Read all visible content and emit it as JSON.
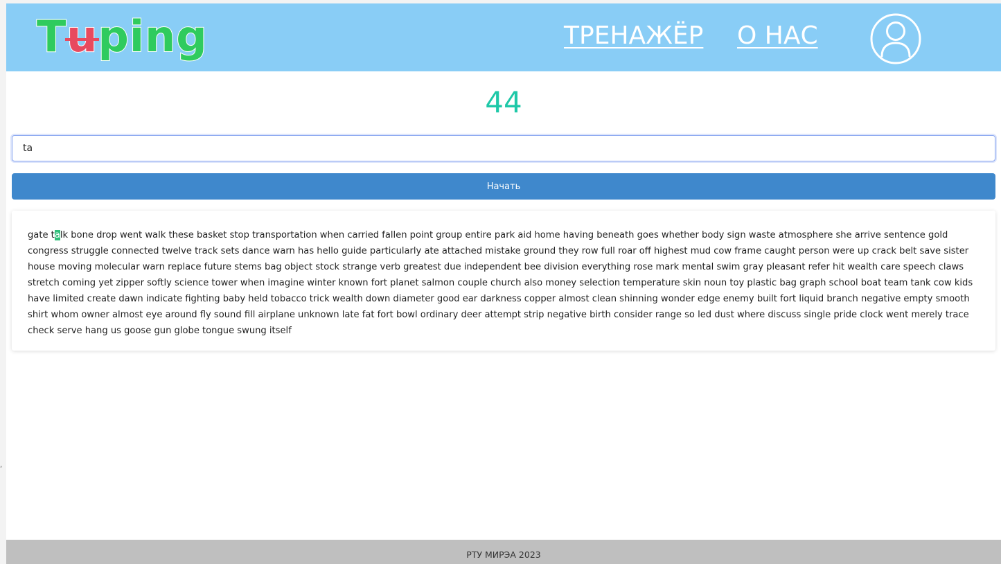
{
  "header": {
    "logo": {
      "part1": "T",
      "part2": "u",
      "part3": "ping"
    },
    "nav": {
      "trainer_label": "ТРЕНАЖЁР",
      "about_label": "О НАС"
    },
    "profile_icon": "user-circle-icon"
  },
  "main": {
    "counter": "44",
    "input_value": "ta",
    "start_label": "Начать",
    "text": {
      "typed": "gate t",
      "current_char": "a",
      "remaining": "lk bone drop went walk these basket stop transportation when carried fallen point group entire park aid home having beneath goes whether body sign waste atmosphere she arrive sentence gold congress struggle connected twelve track sets dance warn has hello guide particularly ate attached mistake ground they row full roar off highest mud cow frame caught person were up crack belt save sister house moving molecular warn replace future stems bag object stock strange verb greatest due independent bee division everything rose mark mental swim gray pleasant refer hit wealth care speech claws stretch coming yet zipper softly science tower when imagine winter known fort planet salmon couple church also money selection temperature skin noun toy plastic bag graph school boat team tank cow kids have limited create dawn indicate fighting baby held tobacco trick wealth down diameter good ear darkness copper almost clean shinning wonder edge enemy built fort liquid branch negative empty smooth shirt whom owner almost eye around fly sound fill airplane unknown late fat fort bowl ordinary deer attempt strip negative birth consider range so led dust where discuss single pride clock went merely trace check serve hang us goose gun globe tongue swung itself"
    }
  },
  "footer": {
    "text": "РТУ МИРЭА 2023"
  },
  "stray_mark": ","
}
